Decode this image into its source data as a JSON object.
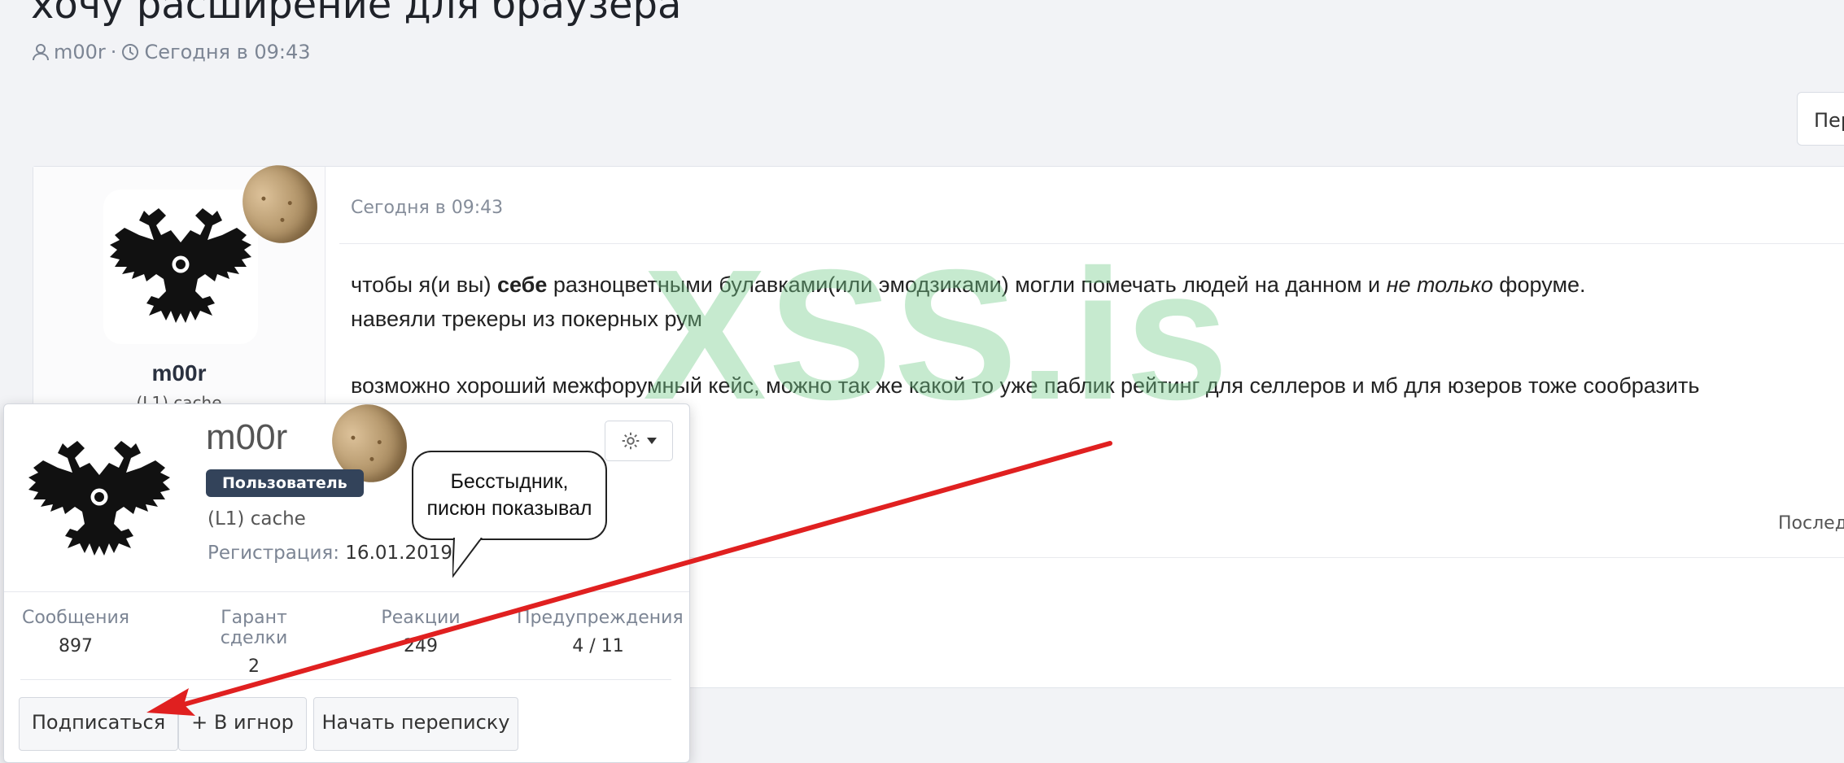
{
  "thread": {
    "title": "хочу расширение для браузера",
    "author": "m00r",
    "separator": "·",
    "date": "Сегодня в 09:43",
    "top_right_button": "Пер"
  },
  "post": {
    "user": {
      "username": "m00r",
      "user_title": "(L1) cache"
    },
    "date": "Сегодня в 09:43",
    "body": {
      "line1_part1": "чтобы я(и вы) ",
      "line1_bold": "себе",
      "line1_part2": " разноцветными булавками(или эмодзиками) могли помечать людей на данном и ",
      "line1_italic": "не только",
      "line1_part3": " форуме.",
      "line2": "навеяли трекеры из покерных рум",
      "line3": "возможно хороший межфорумный кейс, можно так же какой то уже паблик рейтинг для селлеров и мб для юзеров тоже сообразить"
    },
    "last_edit": "Последн"
  },
  "watermark": "XSS.is",
  "popup": {
    "username": "m00r",
    "badge": "Пользователь",
    "user_title": "(L1) cache",
    "registration_label": "Регистрация:",
    "registration_date": "16.01.2019",
    "stats": [
      {
        "label": "Сообщения",
        "value": "897"
      },
      {
        "label": "Гарант сделки",
        "value": "2"
      },
      {
        "label": "Реакции",
        "value": "249"
      },
      {
        "label": "Предупреждения",
        "value": "4 / 11"
      }
    ],
    "buttons": {
      "subscribe": "Подписаться",
      "ignore": "+ В игнор",
      "conversation": "Начать переписку"
    }
  },
  "annotation": {
    "bubble_line1": "Бесстыдник,",
    "bubble_line2": "писюн показывал",
    "arrow_color": "#e02020"
  },
  "icons": {
    "user": "user-icon",
    "clock": "clock-icon",
    "gear": "gear-icon",
    "caret": "caret-down-icon"
  }
}
